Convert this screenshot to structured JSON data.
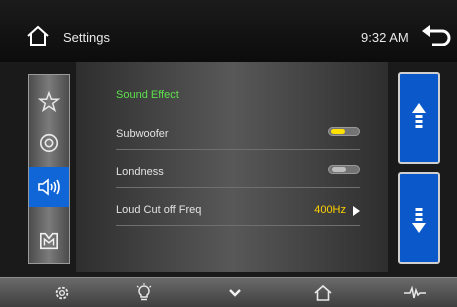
{
  "header": {
    "title": "Settings",
    "time": "9:32 AM",
    "home_icon": "home-icon",
    "back_icon": "back-arrow-icon"
  },
  "categories": [
    {
      "name": "star-icon",
      "active": false
    },
    {
      "name": "target-icon",
      "active": false
    },
    {
      "name": "speaker-icon",
      "active": true
    },
    {
      "name": "logo-icon",
      "active": false
    }
  ],
  "main": {
    "section_title": "Sound Effect",
    "rows": [
      {
        "label": "Subwoofer",
        "type": "toggle",
        "state": "on"
      },
      {
        "label": "Londness",
        "type": "toggle",
        "state": "off"
      },
      {
        "label": "Loud Cut off Freq",
        "type": "value",
        "value": "400Hz"
      }
    ]
  },
  "scroll": {
    "up_icon": "scroll-up-arrow-icon",
    "down_icon": "scroll-down-arrow-icon"
  },
  "bottom_bar": [
    {
      "name": "settings-gear-icon"
    },
    {
      "name": "light-bulb-icon"
    },
    {
      "name": "chevron-down-icon"
    },
    {
      "name": "home-icon"
    },
    {
      "name": "equalizer-icon"
    }
  ],
  "colors": {
    "accent_green": "#5ee04c",
    "accent_yellow": "#ffd200",
    "active_blue": "#1066d6"
  }
}
